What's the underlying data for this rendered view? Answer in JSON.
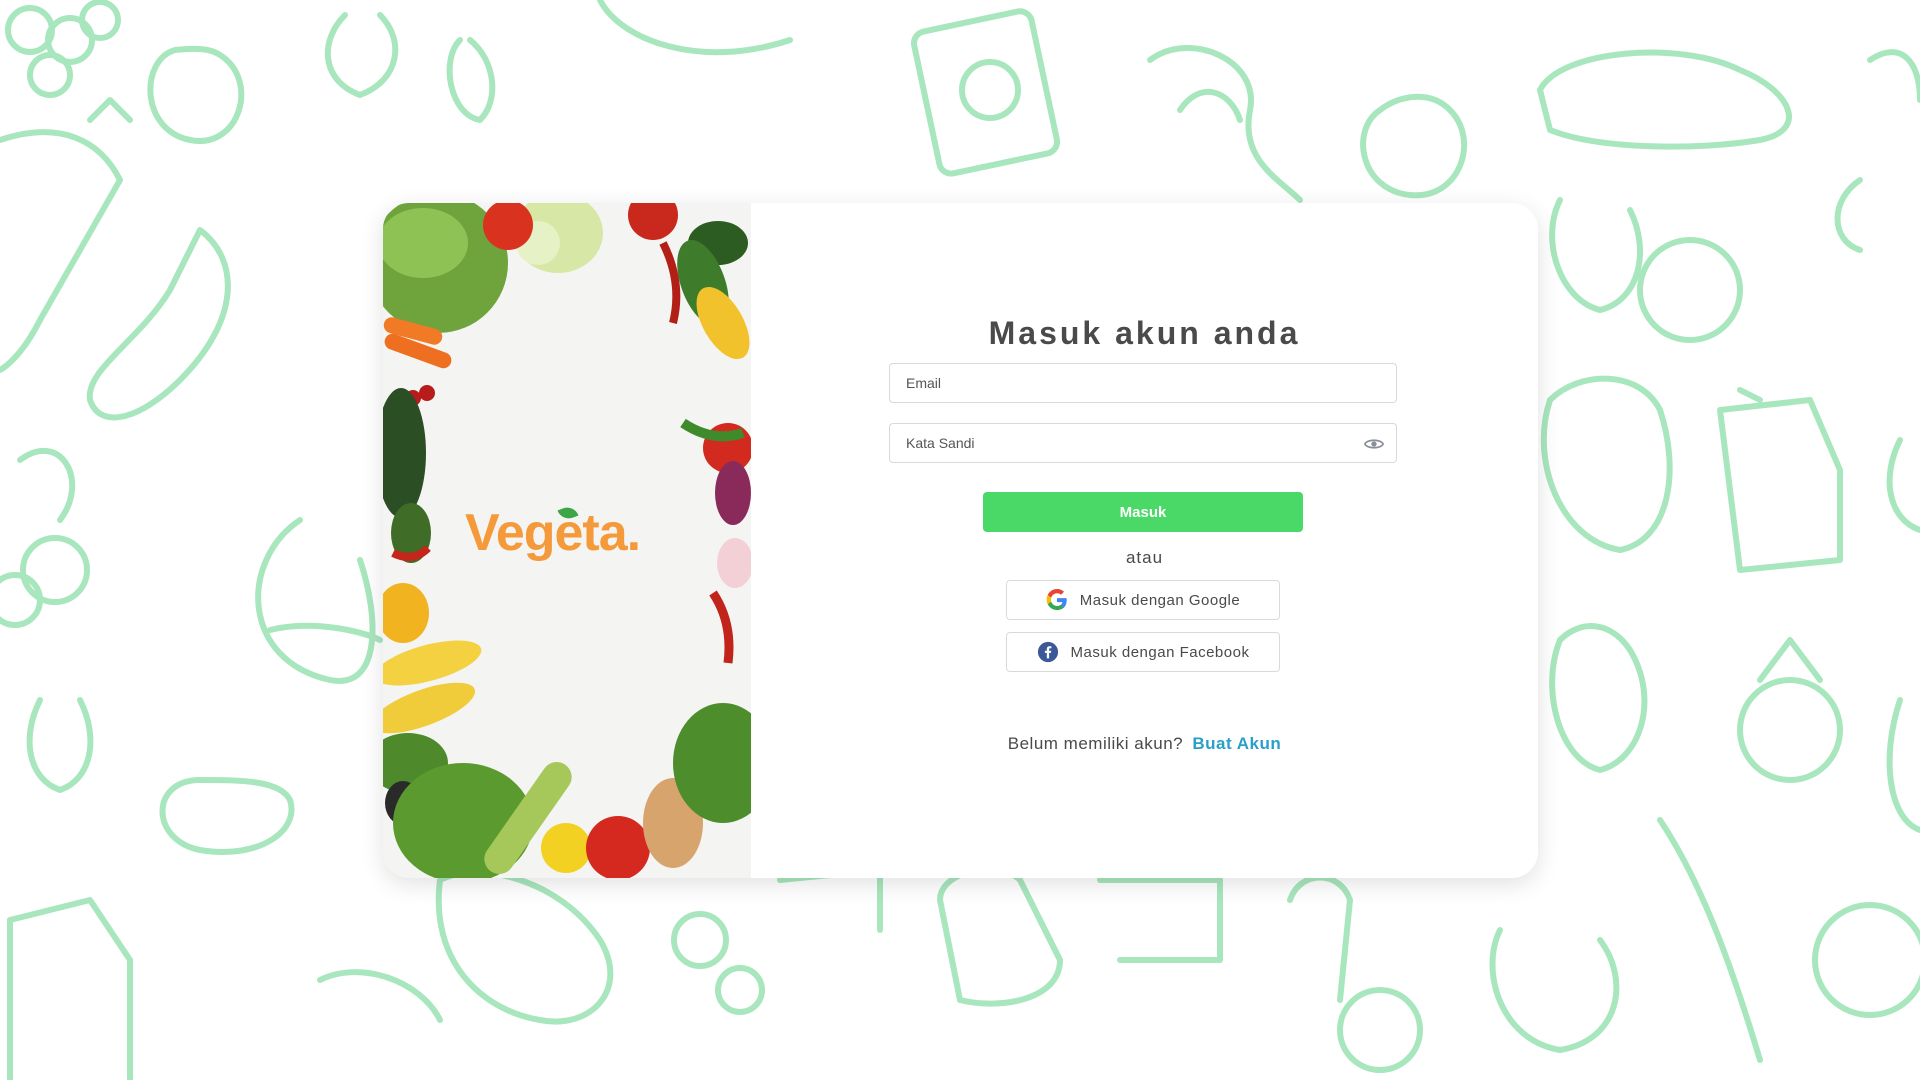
{
  "brand": {
    "name": "Vegeta."
  },
  "login": {
    "title": "Masuk akun anda",
    "email_placeholder": "Email",
    "password_placeholder": "Kata Sandi",
    "submit_label": "Masuk",
    "divider": "atau",
    "google_label": "Masuk dengan Google",
    "facebook_label": "Masuk dengan Facebook",
    "signup_prompt": "Belum memiliki akun?",
    "signup_link": "Buat Akun"
  },
  "icons": {
    "password_toggle": "eye-icon",
    "google": "google-icon",
    "facebook": "facebook-icon"
  },
  "colors": {
    "primary_button": "#4ad867",
    "brand_text": "#f49a3b",
    "link": "#2a9fc9",
    "doodle_stroke": "#a8e6bd",
    "facebook_blue": "#3b5998"
  }
}
